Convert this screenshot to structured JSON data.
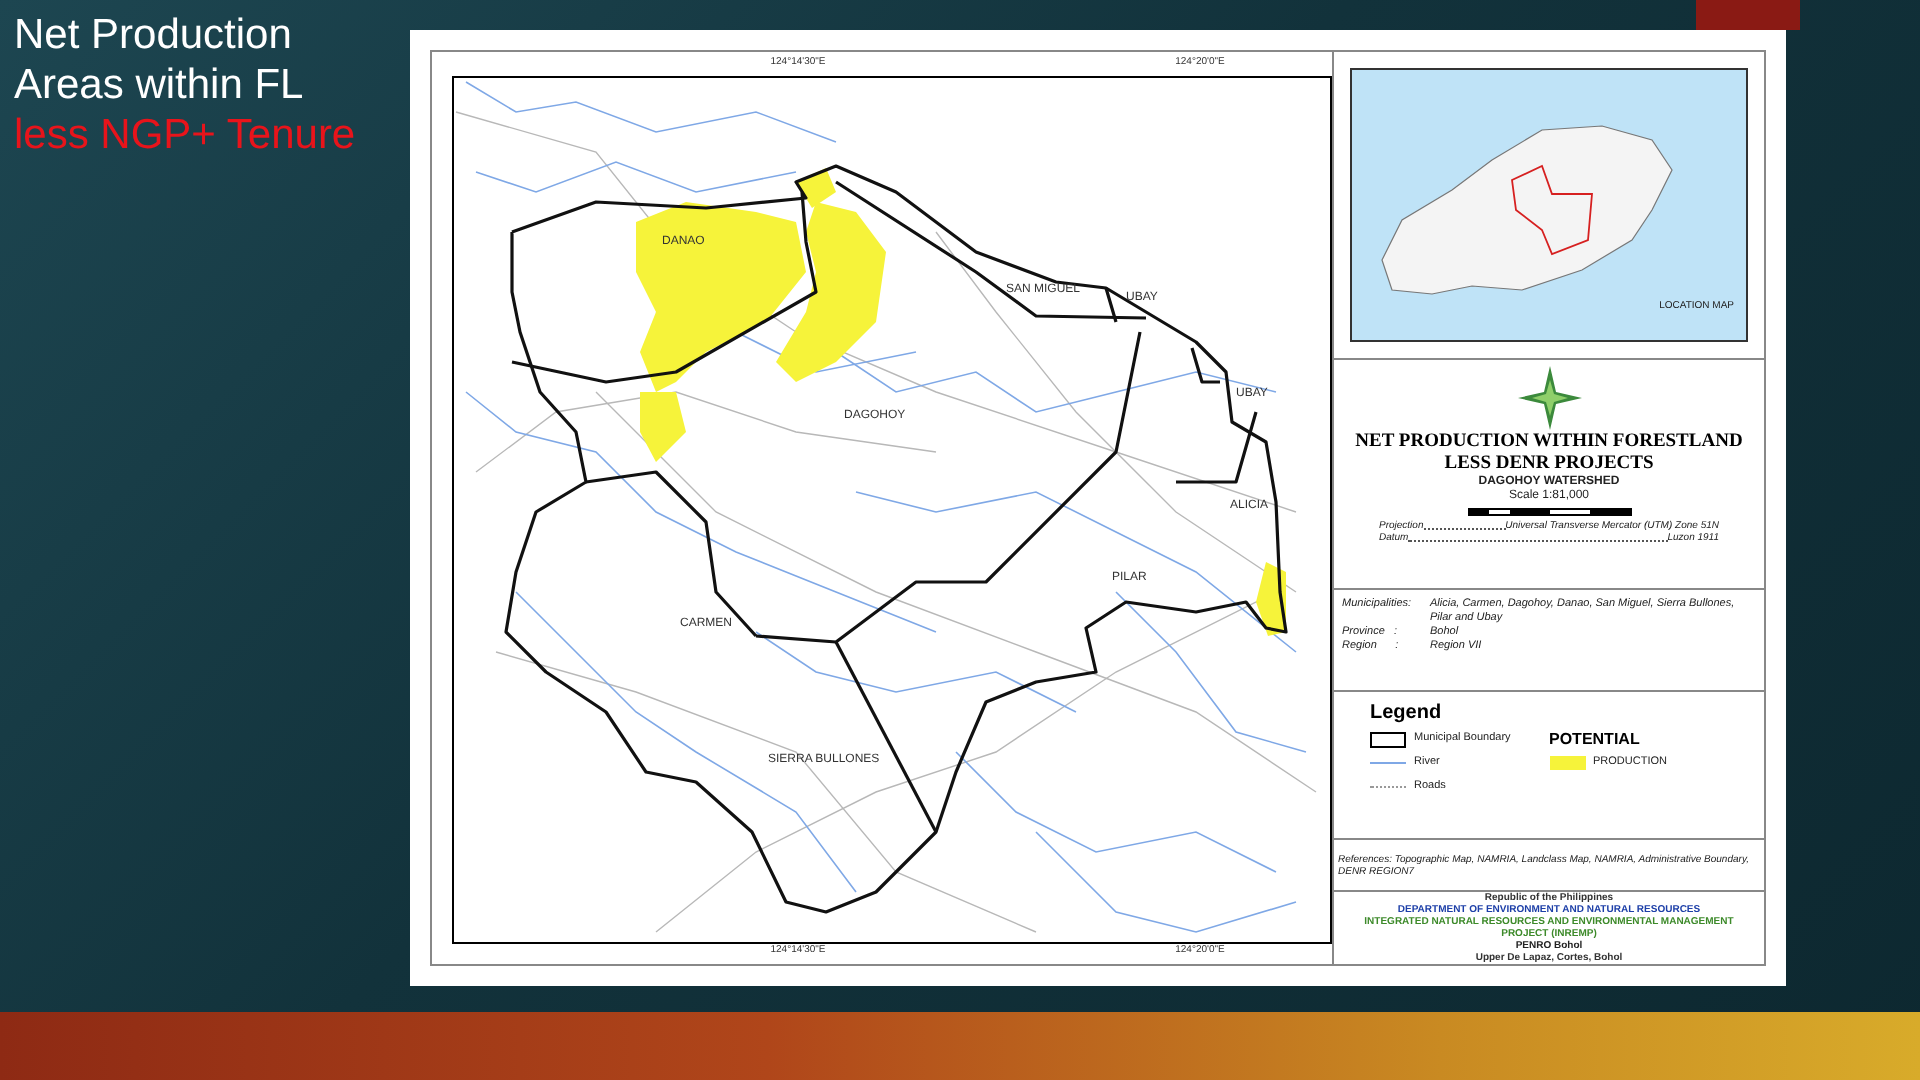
{
  "slide_title": [
    {
      "text": "Net Production",
      "color": "#ffffff"
    },
    {
      "text": "Areas within FL",
      "color": "#ffffff"
    },
    {
      "text": "less NGP+ Tenure",
      "color": "#e8141b"
    }
  ],
  "map": {
    "top_ticks": [
      "124°14'30\"E",
      "124°20'0\"E"
    ],
    "bottom_ticks": [
      "124°14'30\"E",
      "124°20'0\"E"
    ],
    "municipalities": [
      "DANAO",
      "SAN MIGUEL",
      "UBAY",
      "DAGOHOY",
      "UBAY",
      "ALICIA",
      "PILAR",
      "CARMEN",
      "SIERRA BULLONES"
    ]
  },
  "location_map": {
    "label": "LOCATION MAP"
  },
  "title_panel": {
    "title": "NET PRODUCTION WITHIN FORESTLAND LESS DENR PROJECTS",
    "subtitle": "DAGOHOY WATERSHED",
    "scale": "Scale 1:81,000",
    "projection": [
      {
        "label": "Projection",
        "value": "Universal Transverse Mercator (UTM) Zone 51N"
      },
      {
        "label": "Datum",
        "value": "Luzon 1911"
      }
    ]
  },
  "info": [
    {
      "label": "Municipalities:",
      "value": "Alicia, Carmen, Dagohoy, Danao, San Miguel, Sierra Bullones, Pilar and Ubay"
    },
    {
      "label": "Province   :",
      "value": "Bohol"
    },
    {
      "label": "Region      :",
      "value": "Region VII"
    }
  ],
  "legend": {
    "title": "Legend",
    "group_title": "POTENTIAL",
    "items": [
      {
        "kind": "boundary",
        "label": "Municipal Boundary"
      },
      {
        "kind": "river",
        "label": "River"
      },
      {
        "kind": "roads",
        "label": "Roads"
      },
      {
        "kind": "production",
        "label": "PRODUCTION"
      }
    ]
  },
  "references": "References: Topographic Map, NAMRIA, Landclass Map, NAMRIA, Administrative Boundary, DENR REGION7",
  "footer": [
    {
      "text": "Republic of the Philippines",
      "color": "#333333"
    },
    {
      "text": "DEPARTMENT OF ENVIRONMENT AND NATURAL RESOURCES",
      "color": "#1d3fa8"
    },
    {
      "text": "INTEGRATED NATURAL RESOURCES AND ENVIRONMENTAL MANAGEMENT PROJECT (INREMP)",
      "color": "#3d8a2a"
    },
    {
      "text": "PENRO Bohol",
      "color": "#222222"
    },
    {
      "text": "Upper De Lapaz, Cortes, Bohol",
      "color": "#333333"
    }
  ]
}
